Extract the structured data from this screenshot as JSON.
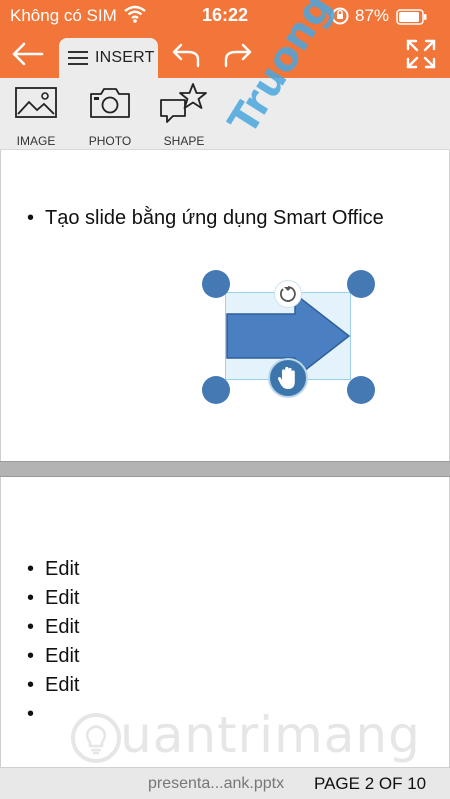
{
  "status_bar": {
    "carrier": "Không có SIM",
    "time": "16:22",
    "battery_percent": "87%",
    "wifi_icon": "wifi-icon",
    "lock_icon": "rotation-lock-icon",
    "battery_icon": "battery-icon"
  },
  "toolbar": {
    "back_icon": "arrow-left-icon",
    "insert_tab_label": "INSERT",
    "menu_icon": "hamburger-menu-icon",
    "undo_icon": "undo-icon",
    "redo_icon": "redo-icon",
    "fullscreen_icon": "fullscreen-icon"
  },
  "ribbon": {
    "tools": [
      {
        "label": "IMAGE",
        "icon": "image-icon"
      },
      {
        "label": "PHOTO",
        "icon": "camera-icon"
      },
      {
        "label": "SHAPE",
        "icon": "shape-icon"
      }
    ]
  },
  "slides": [
    {
      "bullets": [
        "Tạo slide bằng ứng dụng Smart Office"
      ],
      "shape": {
        "type": "right-arrow",
        "fill": "#4a7fc1",
        "selected": true
      }
    },
    {
      "bullets": [
        "Edit",
        "Edit",
        "Edit",
        "Edit",
        "Edit",
        ""
      ]
    }
  ],
  "watermarks": {
    "diagonal": "Truongtin.top",
    "bottom": "uantrimang"
  },
  "footer": {
    "filename": "presenta...ank.pptx",
    "page_indicator": "PAGE 2 OF 10"
  },
  "colors": {
    "accent": "#f2763a",
    "handle": "#4479b4",
    "selection_fill": "#e4f3fb"
  }
}
